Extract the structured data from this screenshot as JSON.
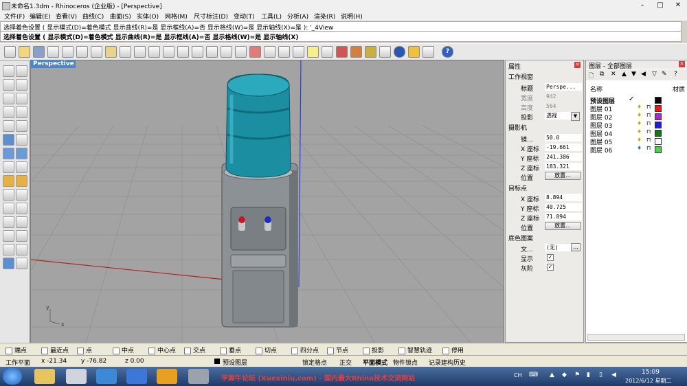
{
  "window": {
    "title": "未命名1.3dm - Rhinoceros (企业版) - [Perspective]"
  },
  "menu": [
    "文件(F)",
    "编辑(E)",
    "查看(V)",
    "曲线(C)",
    "曲面(S)",
    "实体(O)",
    "网格(M)",
    "尺寸标注(D)",
    "变动(T)",
    "工具(L)",
    "分析(A)",
    "渲染(R)",
    "说明(H)"
  ],
  "command": {
    "history": "选择着色设置 ( 显示模式(D)=着色模式  显示曲线(R)=是  显示框线(A)=否  显示格线(W)=是  显示轴线(X)=是 ): '_4View",
    "prompt": "选择着色设置 ( 显示模式(D)=着色模式  显示曲线(R)=是  显示框线(A)=否  显示格线(W)=是  显示轴线(X)"
  },
  "viewport": {
    "label": "Perspective",
    "axis_x": "x",
    "axis_y": "y"
  },
  "properties": {
    "title": "属性",
    "viewport_header": "工作视窗",
    "title_label": "标题",
    "title_value": "Perspe...",
    "width_label": "宽度",
    "width_value": "942",
    "height_label": "高度",
    "height_value": "564",
    "proj_label": "投影",
    "proj_value": "透视",
    "camera_header": "摄影机",
    "lens_label": "镜...",
    "lens_value": "50.0",
    "cx_label": "X 座标",
    "cx_value": "-19.661",
    "cy_label": "Y 座标",
    "cy_value": "241.386",
    "cz_label": "Z 座标",
    "cz_value": "183.321",
    "pos_label": "位置",
    "place_btn": "放置...",
    "target_header": "目标点",
    "tx_label": "X 座标",
    "tx_value": "8.894",
    "ty_label": "Y 座标",
    "ty_value": "40.725",
    "tz_label": "Z 座标",
    "tz_value": "71.894",
    "tpos_label": "位置",
    "tplace_btn": "放置...",
    "bg_header": "底色图案",
    "file_label": "文...",
    "file_value": "(无)",
    "file_btn": "...",
    "show_label": "显示",
    "gray_label": "灰阶"
  },
  "layers": {
    "title": "图层 - 全部图层",
    "col_name": "名称",
    "col_material": "材质",
    "rows": [
      {
        "name": "预设图层",
        "check": "✓",
        "color": "#000000"
      },
      {
        "name": "图层 01",
        "check": "",
        "color": "#e01c1c"
      },
      {
        "name": "图层 02",
        "check": "",
        "color": "#a52cc0"
      },
      {
        "name": "图层 03",
        "check": "",
        "color": "#1d1dd6"
      },
      {
        "name": "图层 04",
        "check": "",
        "color": "#117a11"
      },
      {
        "name": "图层 05",
        "check": "",
        "color": "#ffffff"
      },
      {
        "name": "图层 06",
        "check": "",
        "color": "#4dd24d"
      }
    ]
  },
  "osnap": [
    "端点",
    "最近点",
    "点",
    "中点",
    "中心点",
    "交点",
    "垂点",
    "切点",
    "四分点",
    "节点",
    "投影",
    "智慧轨迹",
    "停用"
  ],
  "status": {
    "cplane": "工作平面",
    "x": "x -21.34",
    "y": "y -76.82",
    "z": "z 0.00",
    "layer": "预设图层",
    "grid_snap": "锁定格点",
    "ortho": "正交",
    "planar": "平面模式",
    "osnap": "物件锁点",
    "history": "记录建构历史"
  },
  "taskbar": {
    "watermark": "学犀牛论坛 (Xuexiniu.com) - 国内最大Rhino技术交流网站",
    "ime": "CH",
    "time": "15:09",
    "date": "2012/6/12 星期二"
  },
  "colors": {
    "viewport_bg": "#a3a3a3",
    "bottle": "#1a8a9c",
    "cabinet": "#8e9397",
    "x_axis": "#b22222",
    "y_axis": "#2a3fd0"
  }
}
